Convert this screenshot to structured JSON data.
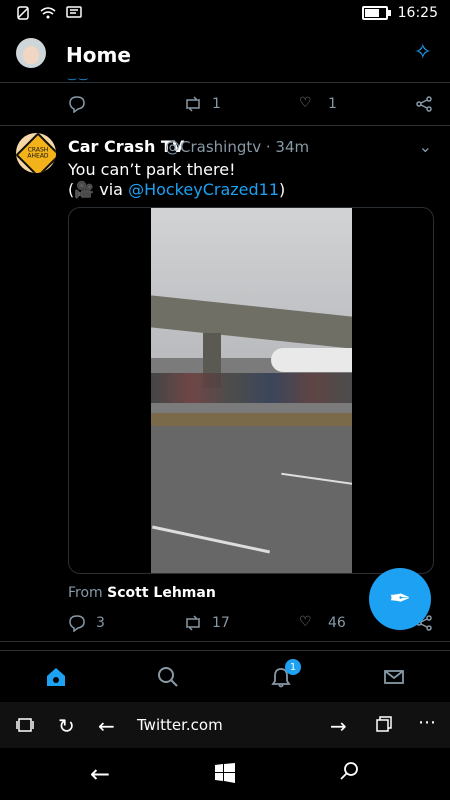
{
  "status": {
    "time": "16:25",
    "icons": [
      "no-sim-icon",
      "wifi-icon",
      "message-icon"
    ],
    "battery_level": 0.8
  },
  "header": {
    "title": "Home"
  },
  "prev_tweet": {
    "retweet_count": "1",
    "like_count": "1"
  },
  "tweet": {
    "name": "Car Crash TV",
    "handle": "@Crashingtv · 34m",
    "text_line1": "You can’t park there!",
    "text_line2_prefix": "(🎥 via ",
    "text_mention": "@HockeyCrazed11",
    "text_line2_suffix": ")",
    "avatar_text": "CRASH AHEAD",
    "from_prefix": "From ",
    "from_name": "Scott Lehman",
    "reply_count": "3",
    "retweet_count": "17",
    "like_count": "46"
  },
  "tabs": [
    {
      "name": "home",
      "icon": "home-icon",
      "active": true
    },
    {
      "name": "search",
      "icon": "search-icon"
    },
    {
      "name": "notifications",
      "icon": "bell-icon",
      "badge": "1"
    },
    {
      "name": "messages",
      "icon": "mail-icon"
    }
  ],
  "browser": {
    "url": "Twitter.com"
  },
  "colors": {
    "accent": "#1da1f2",
    "bg": "#000000",
    "muted": "#8899a6",
    "divider": "#2a2f33"
  }
}
